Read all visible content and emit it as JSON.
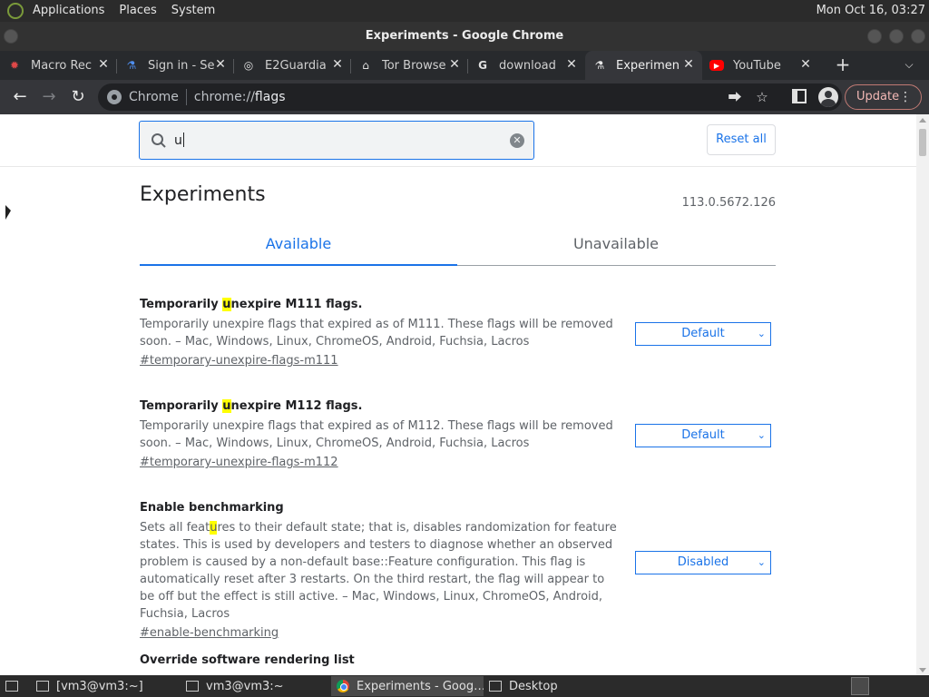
{
  "system": {
    "menus": [
      "Applications",
      "Places",
      "System"
    ],
    "clock": "Mon Oct 16, 03:27"
  },
  "window": {
    "title": "Experiments - Google Chrome"
  },
  "tabs": [
    {
      "label": "Macro Rec",
      "icon": "macro-icon",
      "active": false
    },
    {
      "label": "Sign in - Se",
      "icon": "flask-icon",
      "active": false
    },
    {
      "label": "E2Guardia",
      "icon": "globe-icon",
      "active": false
    },
    {
      "label": "Tor Browse",
      "icon": "building-icon",
      "active": false
    },
    {
      "label": "download",
      "icon": "google-icon",
      "active": false
    },
    {
      "label": "Experimen",
      "icon": "flask-icon",
      "active": true
    },
    {
      "label": "YouTube",
      "icon": "youtube-icon",
      "active": false
    }
  ],
  "toolbar": {
    "omnibox_site": "Chrome",
    "omnibox_scheme": "chrome://",
    "omnibox_path": "flags",
    "update_label": "Update"
  },
  "page": {
    "search_value": "u",
    "reset_label": "Reset all",
    "heading": "Experiments",
    "version": "113.0.5672.126",
    "tab_available": "Available",
    "tab_unavailable": "Unavailable",
    "flags": [
      {
        "name_pre": "Temporarily ",
        "name_hl": "u",
        "name_post": "nexpire M111 flags.",
        "desc_pre": "Temporarily unexpire flags that expired as of M111. These flags will be removed soon. – Mac, Windows, Linux, ChromeOS, Android, Fuchsia, Lacros",
        "desc_hl": "",
        "desc_post": "",
        "link": "#temporary-unexpire-flags-m111",
        "value": "Default"
      },
      {
        "name_pre": "Temporarily ",
        "name_hl": "u",
        "name_post": "nexpire M112 flags.",
        "desc_pre": "Temporarily unexpire flags that expired as of M112. These flags will be removed soon. – Mac, Windows, Linux, ChromeOS, Android, Fuchsia, Lacros",
        "desc_hl": "",
        "desc_post": "",
        "link": "#temporary-unexpire-flags-m112",
        "value": "Default"
      },
      {
        "name_pre": "Enable benchmarking",
        "name_hl": "",
        "name_post": "",
        "desc_pre": "Sets all feat",
        "desc_hl": "u",
        "desc_post": "res to their default state; that is, disables randomization for feature states. This is used by developers and testers to diagnose whether an observed problem is caused by a non-default base::Feature configuration. This flag is automatically reset after 3 restarts. On the third restart, the flag will appear to be off but the effect is still active. – Mac, Windows, Linux, ChromeOS, Android, Fuchsia, Lacros",
        "link": "#enable-benchmarking",
        "value": "Disabled"
      },
      {
        "name_pre": "Override software rendering list",
        "name_hl": "",
        "name_post": "",
        "desc_pre": "",
        "desc_hl": "",
        "desc_post": "",
        "link": "",
        "value": ""
      }
    ]
  },
  "taskbar": [
    {
      "label": "[vm3@vm3:~]",
      "icon": "terminal-icon"
    },
    {
      "label": "vm3@vm3:~",
      "icon": "terminal-icon"
    },
    {
      "label": "Experiments - Goog…",
      "icon": "chrome-icon"
    },
    {
      "label": "Desktop",
      "icon": "desktop-icon"
    }
  ],
  "colors": {
    "accent": "#1a73e8",
    "highlight": "#ffff00",
    "chrome_frame": "#35363a"
  }
}
